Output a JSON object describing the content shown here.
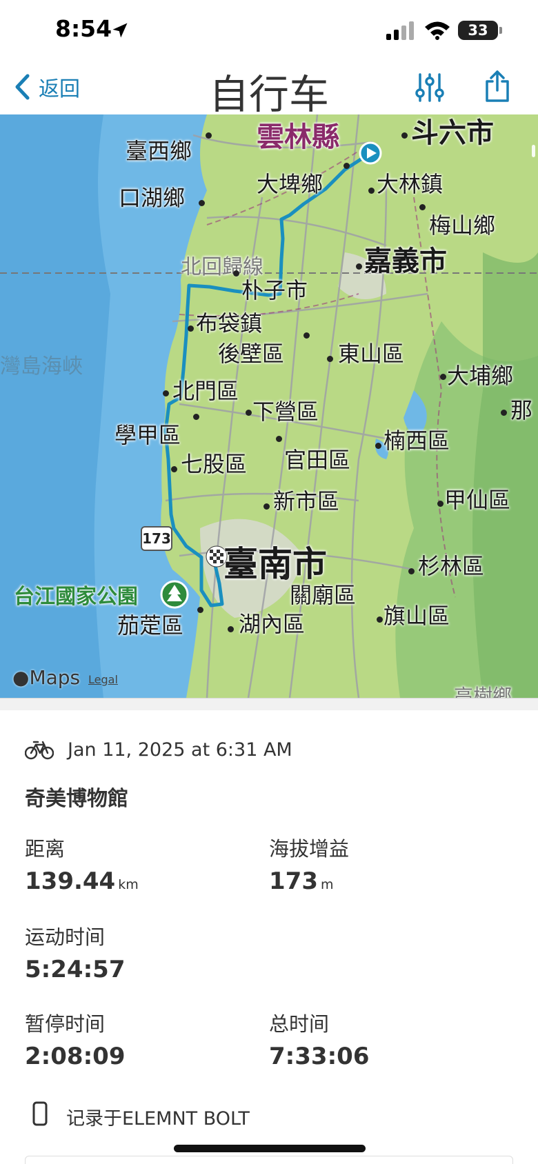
{
  "status_bar": {
    "time": "8:54",
    "battery": "33"
  },
  "nav": {
    "back_label": "返回",
    "title": "自行车"
  },
  "map": {
    "labels": {
      "yunlin": "雲林縣",
      "douliu": "斗六市",
      "taixi": "臺西鄉",
      "dapi": "大埤鄉",
      "dalin": "大林鎮",
      "kouhu": "口湖鄉",
      "meishan": "梅山鄉",
      "tropic": "北回歸線",
      "chiayi": "嘉義市",
      "puzi": "朴子市",
      "strait": "灣島海峽",
      "budai": "布袋鎮",
      "houbi": "後壁區",
      "dongshan": "東山區",
      "dapu": "大埔鄉",
      "beimen": "北門區",
      "xiaying": "下營區",
      "na": "那",
      "xuejia": "學甲區",
      "guantian": "官田區",
      "nanxi": "楠西區",
      "qigu": "七股區",
      "xinshi": "新市區",
      "jiaxian": "甲仙區",
      "park": "台江國家公園",
      "tainan": "臺南市",
      "shanlin": "杉林區",
      "guanmiao": "關廟區",
      "qishan": "旗山區",
      "qieding": "茄萣區",
      "hunei": "湖內區",
      "gaoshu": "高樹鄉"
    },
    "route_shield": "173",
    "maps_logo": "Maps",
    "legal": "Legal",
    "route_color": "#1a8fbf"
  },
  "ride": {
    "date": "Jan 11, 2025 at 6:31 AM",
    "name": "奇美博物館",
    "distance_label": "距离",
    "distance_value": "139.44",
    "distance_unit": "km",
    "elevation_label": "海拔增益",
    "elevation_value": "173",
    "elevation_unit": "m",
    "moving_time_label": "运动时间",
    "moving_time_value": "5:24:57",
    "paused_time_label": "暂停时间",
    "paused_time_value": "2:08:09",
    "total_time_label": "总时间",
    "total_time_value": "7:33:06",
    "device_text": "记录于ELEMNT BOLT"
  },
  "colors": {
    "accent": "#1a7fb5",
    "sea": "#6fb8e6",
    "land": "#b9d985"
  },
  "icons": [
    "location-arrow-icon",
    "signal-icon",
    "wifi-icon",
    "battery-icon",
    "chevron-left-icon",
    "sliders-icon",
    "share-icon",
    "bicycle-icon",
    "device-icon",
    "start-play-icon",
    "finish-flag-icon",
    "tree-icon",
    "apple-icon"
  ]
}
